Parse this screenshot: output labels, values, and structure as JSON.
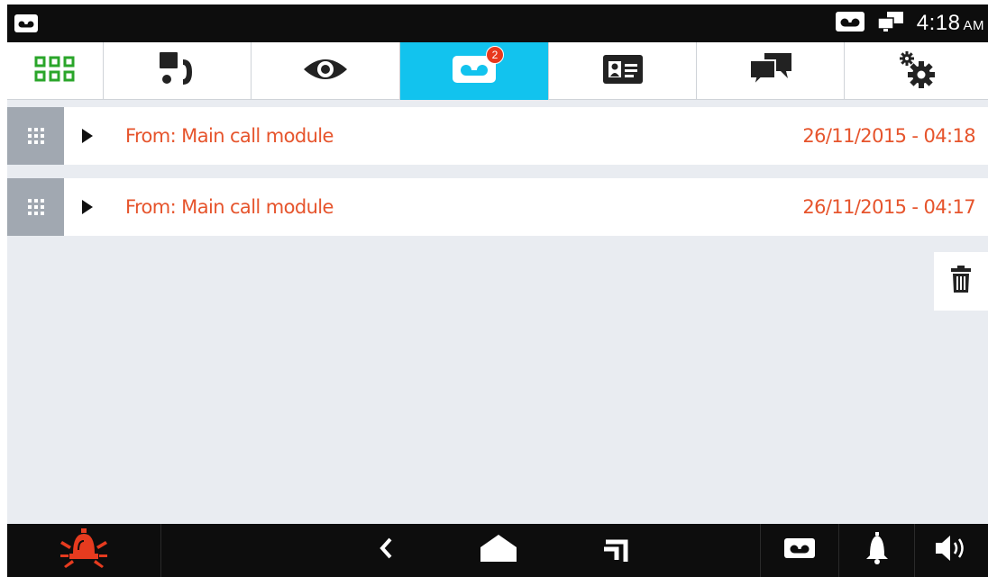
{
  "statusbar": {
    "left_icon": "voicemail-icon",
    "icons": [
      "voicemail-icon",
      "network-icon"
    ],
    "time": "4:18",
    "ampm": "AM"
  },
  "tabs": [
    {
      "icon": "apps-grid-icon",
      "color": "#2aa52a",
      "active": false
    },
    {
      "icon": "intercom-call-icon",
      "active": false
    },
    {
      "icon": "eye-icon",
      "active": false
    },
    {
      "icon": "voicemail-icon",
      "active": true,
      "badge": "2"
    },
    {
      "icon": "contact-card-icon",
      "active": false
    },
    {
      "icon": "chat-bubbles-icon",
      "active": false
    },
    {
      "icon": "settings-gears-icon",
      "active": false
    }
  ],
  "messages": [
    {
      "from": "From: Main call module",
      "date": "26/11/2015 - 04:18"
    },
    {
      "from": "From: Main call module",
      "date": "26/11/2015 - 04:17"
    }
  ],
  "navbar": {
    "items": [
      "alarm-icon",
      "back-icon",
      "home-icon",
      "recent-apps-icon",
      "voicemail-icon",
      "bell-icon",
      "volume-icon"
    ],
    "alarm_color": "#e63b1f"
  },
  "colors": {
    "accent": "#12c3ee",
    "text_accent": "#e6542c",
    "badge": "#e8381d"
  }
}
